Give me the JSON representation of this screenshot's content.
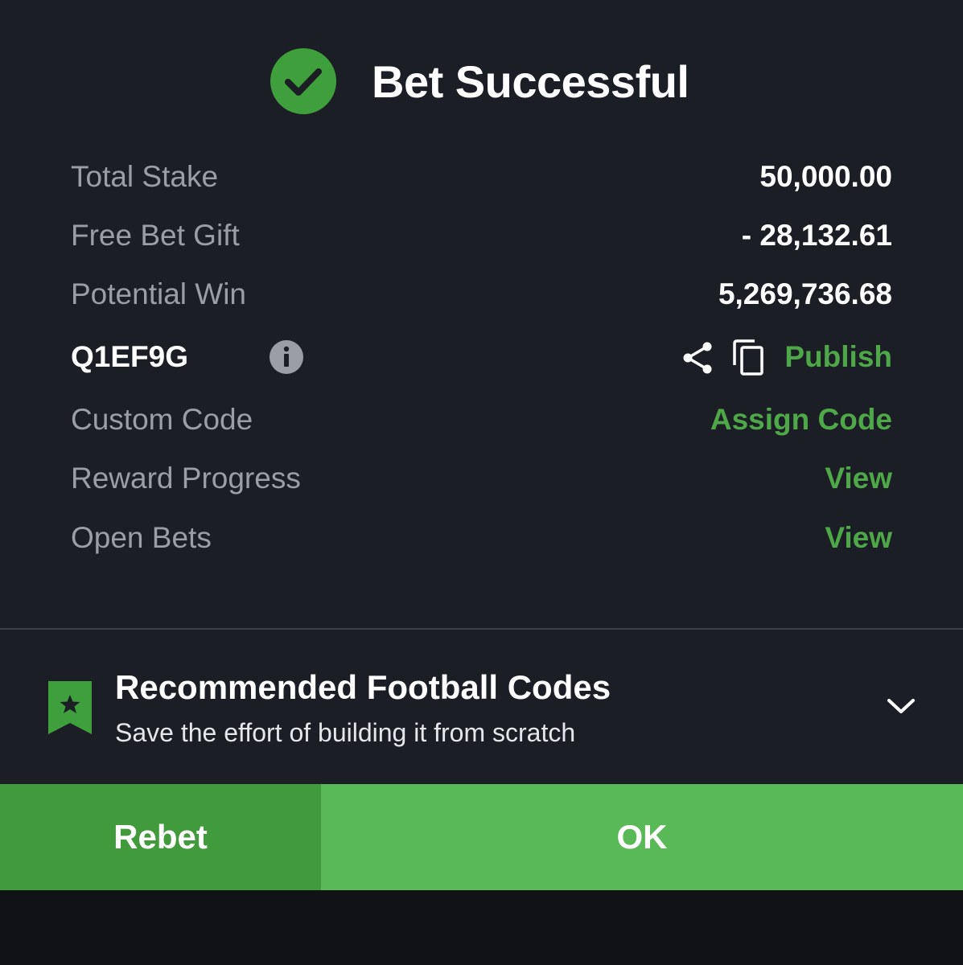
{
  "header": {
    "title": "Bet Successful",
    "icon": "check-circle-icon"
  },
  "summary": {
    "total_stake": {
      "label": "Total Stake",
      "value": "50,000.00"
    },
    "free_bet_gift": {
      "label": "Free Bet Gift",
      "value": "- 28,132.61"
    },
    "potential_win": {
      "label": "Potential Win",
      "value": "5,269,736.68"
    },
    "booking_code": {
      "code": "Q1EF9G",
      "info_icon": "info-icon",
      "share_icon": "share-icon",
      "copy_icon": "copy-icon",
      "publish_label": "Publish"
    },
    "custom_code": {
      "label": "Custom Code",
      "action": "Assign Code"
    },
    "reward_progress": {
      "label": "Reward Progress",
      "action": "View"
    },
    "open_bets": {
      "label": "Open Bets",
      "action": "View"
    }
  },
  "recommended": {
    "title": "Recommended Football Codes",
    "subtitle": "Save the effort of building it from scratch",
    "icon": "bookmark-star-icon",
    "toggle_icon": "chevron-down-icon"
  },
  "actions": {
    "rebet_label": "Rebet",
    "ok_label": "OK"
  },
  "colors": {
    "accent_green": "#4ea748",
    "ok_button": "#5ab957",
    "rebet_button": "#419a3b",
    "panel_bg": "#1b1e24",
    "muted_text": "#9a9ea6"
  }
}
